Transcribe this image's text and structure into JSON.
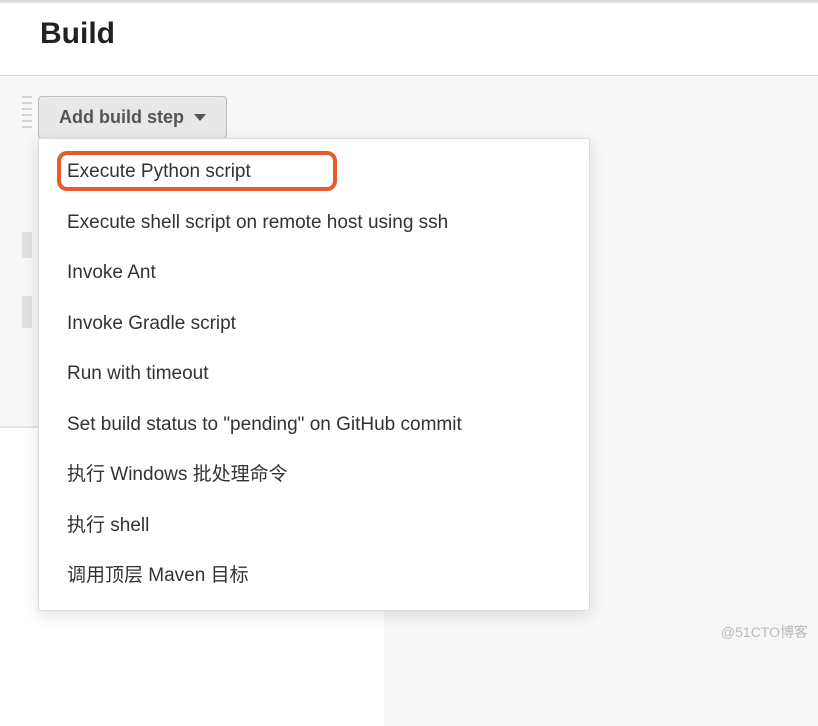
{
  "section": {
    "title": "Build"
  },
  "addButton": {
    "label": "Add build step"
  },
  "menu": {
    "items": [
      {
        "label": "Execute Python script",
        "highlighted": true
      },
      {
        "label": "Execute shell script on remote host using ssh",
        "highlighted": false
      },
      {
        "label": "Invoke Ant",
        "highlighted": false
      },
      {
        "label": "Invoke Gradle script",
        "highlighted": false
      },
      {
        "label": "Run with timeout",
        "highlighted": false
      },
      {
        "label": "Set build status to \"pending\" on GitHub commit",
        "highlighted": false
      },
      {
        "label": "执行 Windows 批处理命令",
        "highlighted": false
      },
      {
        "label": "执行 shell",
        "highlighted": false
      },
      {
        "label": "调用顶层 Maven 目标",
        "highlighted": false
      }
    ]
  },
  "watermark": "@51CTO博客"
}
